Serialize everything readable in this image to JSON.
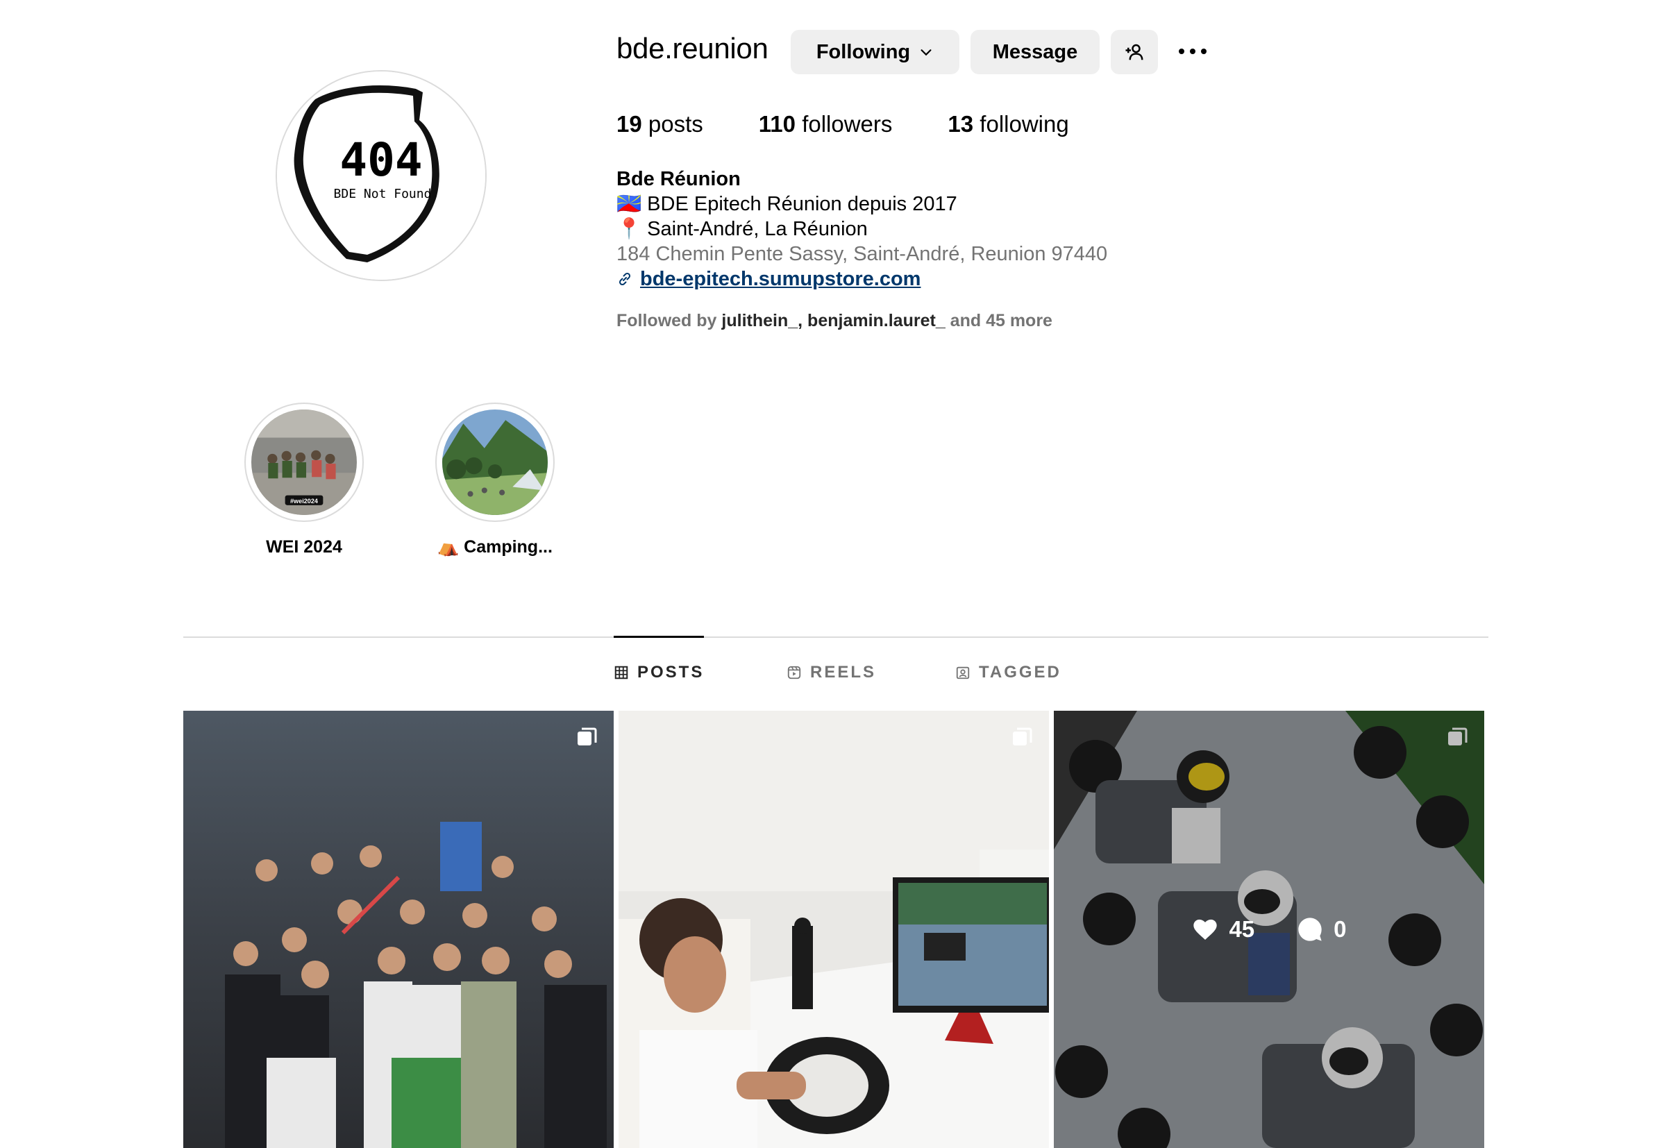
{
  "profile": {
    "username": "bde.reunion",
    "avatar_title": "404",
    "avatar_subtitle": "BDE Not Found",
    "following_label": "Following",
    "message_label": "Message"
  },
  "stats": {
    "posts_count": "19",
    "posts_label": "posts",
    "followers_count": "110",
    "followers_label": "followers",
    "following_count": "13",
    "following_label": "following"
  },
  "bio": {
    "name": "Bde Réunion",
    "line1_emoji": "🇷🇪",
    "line1": "BDE Epitech Réunion depuis 2017",
    "line2_emoji": "📍",
    "line2": "Saint-André, La Réunion",
    "address": "184 Chemin Pente Sassy, Saint-André, Reunion 97440",
    "link": "bde-epitech.sumupstore.com"
  },
  "followed_by": {
    "prefix": "Followed by",
    "user1": "julithein_",
    "separator": ", ",
    "user2": "benjamin.lauret_",
    "suffix": "and 45 more"
  },
  "highlights": [
    {
      "label": "WEI 2024",
      "badge": "#wei2024"
    },
    {
      "label": "⛺ Camping..."
    }
  ],
  "tabs": [
    {
      "label": "POSTS",
      "icon": "grid-icon",
      "active": true
    },
    {
      "label": "REELS",
      "icon": "reels-icon",
      "active": false
    },
    {
      "label": "TAGGED",
      "icon": "tagged-icon",
      "active": false
    }
  ],
  "posts": [
    {
      "multi": true
    },
    {
      "multi": true
    },
    {
      "multi": true,
      "likes": "45",
      "comments": "0"
    }
  ]
}
